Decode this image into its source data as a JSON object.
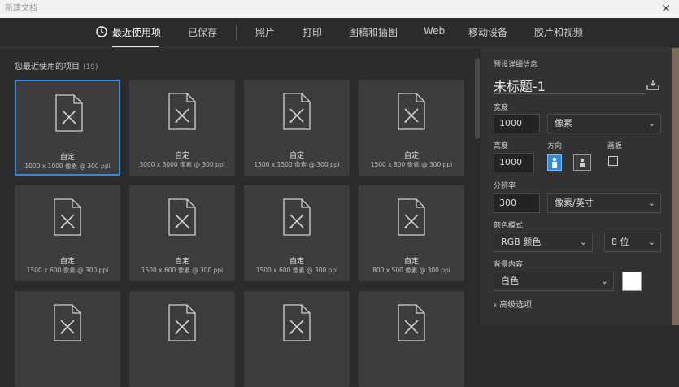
{
  "window": {
    "title": "新建文档"
  },
  "tabs": [
    {
      "label": "最近使用项",
      "active": true,
      "icon": "clock-icon"
    },
    {
      "label": "已保存"
    },
    {
      "label": "照片"
    },
    {
      "label": "打印"
    },
    {
      "label": "图稿和插图"
    },
    {
      "label": "Web"
    },
    {
      "label": "移动设备"
    },
    {
      "label": "胶片和视频"
    }
  ],
  "recent": {
    "title": "您最近使用的项目",
    "count": "(19)",
    "items": [
      {
        "name": "自定",
        "dims": "1000 x 1000 像素 @ 300 ppi"
      },
      {
        "name": "自定",
        "dims": "3000 x 3000 像素 @ 300 ppi"
      },
      {
        "name": "自定",
        "dims": "1500 x 1500 像素 @ 300 ppi"
      },
      {
        "name": "自定",
        "dims": "1500 x 800 像素 @ 300 ppi"
      },
      {
        "name": "自定",
        "dims": "1500 x 600 像素 @ 300 ppi"
      },
      {
        "name": "自定",
        "dims": "1500 x 600 像素 @ 300 ppi"
      },
      {
        "name": "自定",
        "dims": "1500 x 600 像素 @ 300 ppi"
      },
      {
        "name": "自定",
        "dims": "800 x 500 像素 @ 300 ppi"
      }
    ]
  },
  "preset": {
    "header": "预设详细信息",
    "doc_title": "未标题-1",
    "width_label": "宽度",
    "width_value": "1000",
    "width_unit": "像素",
    "height_label": "高度",
    "height_value": "1000",
    "orientation_label": "方向",
    "artboard_label": "画板",
    "resolution_label": "分辨率",
    "resolution_value": "300",
    "resolution_unit": "像素/英寸",
    "color_mode_label": "颜色模式",
    "color_mode_value": "RGB 颜色",
    "bit_depth": "8 位",
    "background_label": "背景内容",
    "background_value": "白色",
    "background_color": "#ffffff",
    "advanced_label": "高级选项"
  },
  "colors": {
    "accent": "#2d8ceb",
    "panel": "#323232",
    "card": "#3c3c3c"
  }
}
